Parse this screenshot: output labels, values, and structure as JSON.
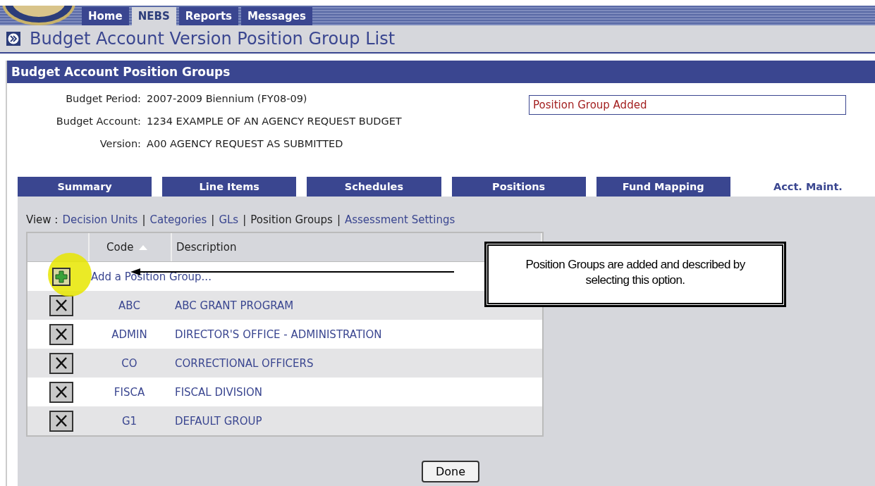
{
  "nav_tabs": [
    {
      "label": "Home",
      "selected": false
    },
    {
      "label": "NEBS",
      "selected": true
    },
    {
      "label": "Reports",
      "selected": false
    },
    {
      "label": "Messages",
      "selected": false
    }
  ],
  "page_title": "Budget Account Version Position Group List",
  "section_title": "Budget Account Position Groups",
  "info": [
    {
      "label": "Budget Period:",
      "value": "2007-2009 Biennium (FY08-09)"
    },
    {
      "label": "Budget Account:",
      "value": "1234 EXAMPLE OF AN AGENCY REQUEST BUDGET"
    },
    {
      "label": "Version:",
      "value": "A00 AGENCY REQUEST AS SUBMITTED"
    }
  ],
  "status_message": "Position Group Added",
  "tabs": [
    {
      "label": "Summary",
      "selected": false
    },
    {
      "label": "Line Items",
      "selected": false
    },
    {
      "label": "Schedules",
      "selected": false
    },
    {
      "label": "Positions",
      "selected": false
    },
    {
      "label": "Fund Mapping",
      "selected": false
    },
    {
      "label": "Acct. Maint.",
      "selected": true
    }
  ],
  "view": {
    "label": "View :",
    "separator": "|",
    "links": [
      {
        "label": "Decision Units",
        "selected": false
      },
      {
        "label": "Categories",
        "selected": false
      },
      {
        "label": "GLs",
        "selected": false
      },
      {
        "label": "Position Groups",
        "selected": true
      },
      {
        "label": "Assessment Settings",
        "selected": false
      }
    ]
  },
  "table": {
    "columns": [
      "Code",
      "Description"
    ],
    "add_label": "Add a Position Group...",
    "rows": [
      {
        "code": "ABC",
        "description": "ABC GRANT PROGRAM"
      },
      {
        "code": "ADMIN",
        "description": "DIRECTOR'S OFFICE - ADMINISTRATION"
      },
      {
        "code": "CO",
        "description": "CORRECTIONAL OFFICERS"
      },
      {
        "code": "FISCA",
        "description": "FISCAL DIVISION"
      },
      {
        "code": "G1",
        "description": "DEFAULT GROUP"
      }
    ]
  },
  "callout": "Position Groups are added and described by selecting this option.",
  "done_button": "Done"
}
